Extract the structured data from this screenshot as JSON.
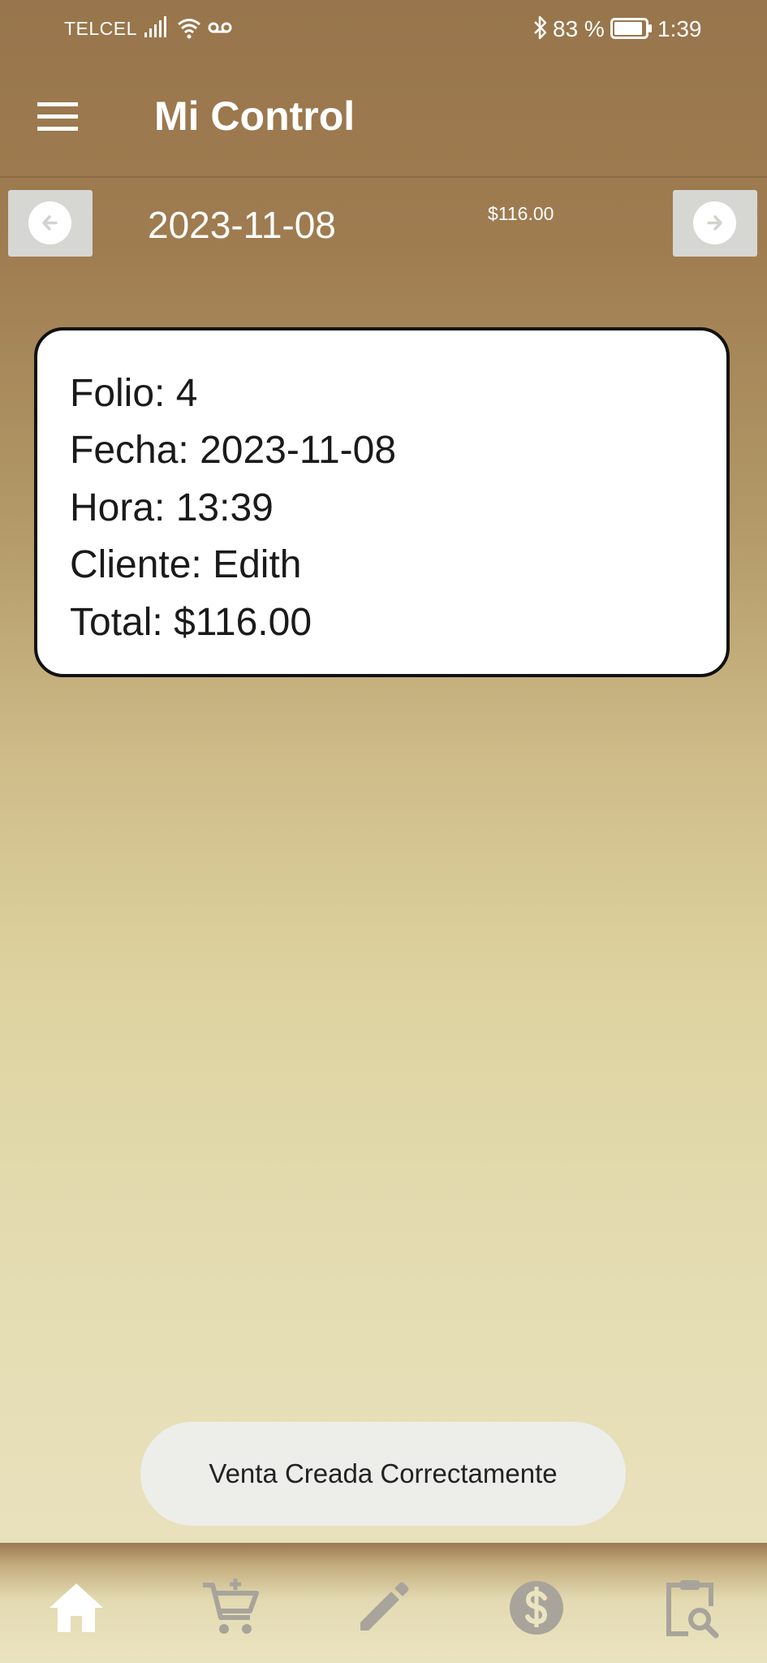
{
  "status_bar": {
    "carrier": "TELCEL",
    "battery": "83 %",
    "time": "1:39"
  },
  "app_bar": {
    "title": "Mi Control"
  },
  "date_nav": {
    "date": "2023-11-08",
    "total": "$116.00"
  },
  "sales": [
    {
      "folio": "Folio: 4",
      "fecha": "Fecha: 2023-11-08",
      "hora": "Hora: 13:39",
      "cliente": "Cliente: Edith",
      "total": "Total: $116.00"
    }
  ],
  "toast": {
    "message": "Venta Creada Correctamente"
  },
  "bottom_nav": {
    "items": [
      {
        "icon": "home-icon",
        "active": true
      },
      {
        "icon": "add-cart-icon",
        "active": false
      },
      {
        "icon": "pencil-icon",
        "active": false
      },
      {
        "icon": "dollar-icon",
        "active": false
      },
      {
        "icon": "clipboard-search-icon",
        "active": false
      }
    ]
  },
  "colors": {
    "header_brown": "#98754c",
    "background_light": "#e9e2be",
    "nav_active": "#ffffff",
    "nav_inactive": "#a8a49b"
  }
}
